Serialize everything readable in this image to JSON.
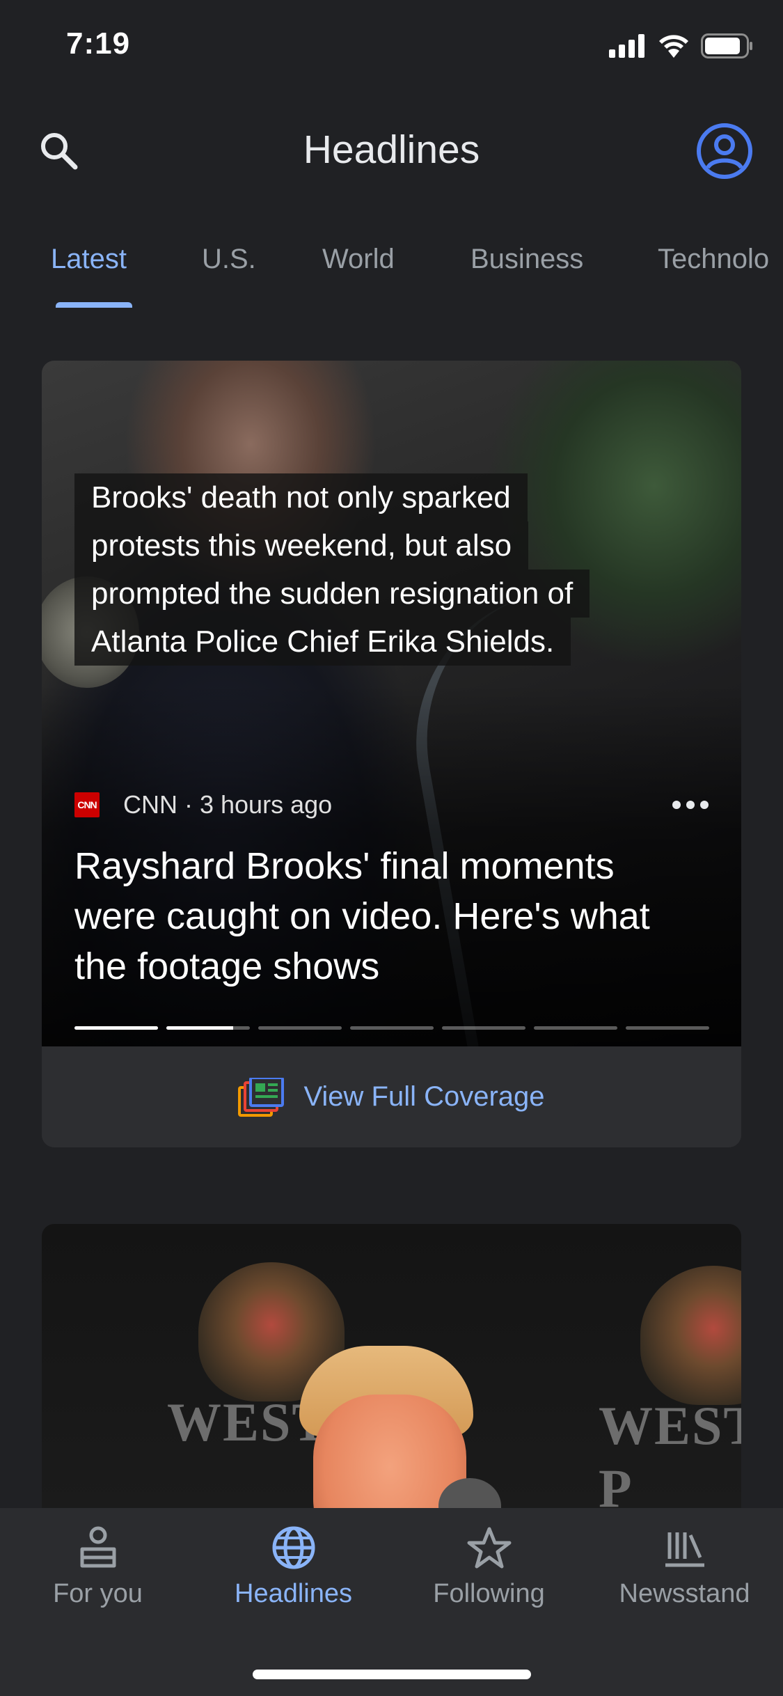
{
  "status_bar": {
    "time": "7:19",
    "icons": [
      "signal-icon",
      "wifi-icon",
      "battery-icon"
    ]
  },
  "header": {
    "title": "Headlines",
    "search_icon": "search-icon",
    "account_icon": "account-circle-icon"
  },
  "tabs": [
    {
      "label": "Latest",
      "active": true
    },
    {
      "label": "U.S.",
      "active": false
    },
    {
      "label": "World",
      "active": false
    },
    {
      "label": "Business",
      "active": false
    },
    {
      "label": "Technolo",
      "active": false
    }
  ],
  "story_card": {
    "caption_lines": [
      "Brooks' death not only sparked",
      "protests this weekend, but also",
      "prompted the sudden resignation of",
      "Atlanta Police Chief Erika Shields."
    ],
    "source_logo_text": "CNN",
    "source": "CNN · 3 hours ago",
    "headline": "Rayshard Brooks' final moments were caught on video. Here's what the footage shows",
    "slide_progress": [
      1,
      0.8,
      0,
      0,
      0,
      0,
      0
    ],
    "full_coverage_label": "View Full Coverage"
  },
  "second_card": {
    "backdrop_text_left": "WEST P",
    "backdrop_text_right": "WEST P"
  },
  "bottom_nav": [
    {
      "label": "For you",
      "icon": "for-you-icon",
      "active": false
    },
    {
      "label": "Headlines",
      "icon": "globe-icon",
      "active": true
    },
    {
      "label": "Following",
      "icon": "star-icon",
      "active": false
    },
    {
      "label": "Newsstand",
      "icon": "newsstand-icon",
      "active": false
    }
  ],
  "colors": {
    "background": "#202124",
    "accent": "#8ab4f8",
    "inactive": "#9aa0a6",
    "nav_background": "#2b2c2f"
  }
}
